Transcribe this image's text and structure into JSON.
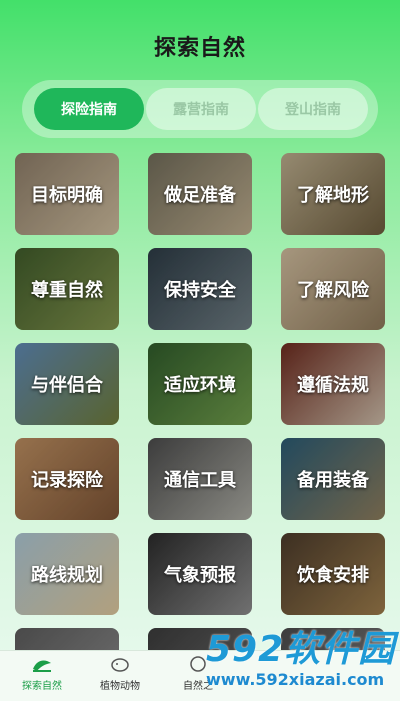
{
  "page_title": "探索自然",
  "tabs": [
    {
      "label": "探险指南",
      "active": true
    },
    {
      "label": "露营指南",
      "active": false
    },
    {
      "label": "登山指南",
      "active": false
    }
  ],
  "tiles": [
    {
      "label": "目标明确",
      "colors": [
        "#8a7a66",
        "#c9b89a"
      ]
    },
    {
      "label": "做足准备",
      "colors": [
        "#6f6a58",
        "#b8a88a"
      ]
    },
    {
      "label": "了解地形",
      "colors": [
        "#b7a98a",
        "#6a5a3c"
      ]
    },
    {
      "label": "尊重自然",
      "colors": [
        "#3f5a2a",
        "#7e8f4a"
      ]
    },
    {
      "label": "保持安全",
      "colors": [
        "#2c3a44",
        "#6c7a80"
      ]
    },
    {
      "label": "了解风险",
      "colors": [
        "#cbb89a",
        "#8a7658"
      ]
    },
    {
      "label": "与伴侣合",
      "colors": [
        "#5d86b0",
        "#6d7a3a"
      ]
    },
    {
      "label": "适应环境",
      "colors": [
        "#2f5a2a",
        "#6e9a4a"
      ]
    },
    {
      "label": "遵循法规",
      "colors": [
        "#6a2a1e",
        "#c9b9a6"
      ]
    },
    {
      "label": "记录探险",
      "colors": [
        "#b78a5e",
        "#7a5234"
      ]
    },
    {
      "label": "通信工具",
      "colors": [
        "#4a4a4a",
        "#a8a8a0"
      ]
    },
    {
      "label": "备用装备",
      "colors": [
        "#2a5a72",
        "#8a7a5a"
      ]
    },
    {
      "label": "路线规划",
      "colors": [
        "#a9c3cf",
        "#d9c49a"
      ]
    },
    {
      "label": "气象预报",
      "colors": [
        "#2a2a2a",
        "#8a8a8a"
      ]
    },
    {
      "label": "饮食安排",
      "colors": [
        "#4a3a2a",
        "#9a7a4a"
      ]
    },
    {
      "label": "",
      "colors": [
        "#5a5a5a",
        "#8a8a8a"
      ]
    },
    {
      "label": "",
      "colors": [
        "#3a3a3a",
        "#6a6a6a"
      ]
    },
    {
      "label": "",
      "colors": [
        "#4a4a4a",
        "#7a7a7a"
      ]
    }
  ],
  "bottom_nav": [
    {
      "label": "探索自然",
      "icon": "sprout-icon",
      "active": true
    },
    {
      "label": "植物动物",
      "icon": "animal-icon",
      "active": false
    },
    {
      "label": "自然之",
      "icon": "nature-icon",
      "active": false
    }
  ],
  "watermark": {
    "brand": "592软件园",
    "url": "www.592xiazai.com"
  },
  "colors": {
    "accent": "#1fb75a",
    "title": "#1a1a1a",
    "watermark": "#1e9ad6"
  }
}
